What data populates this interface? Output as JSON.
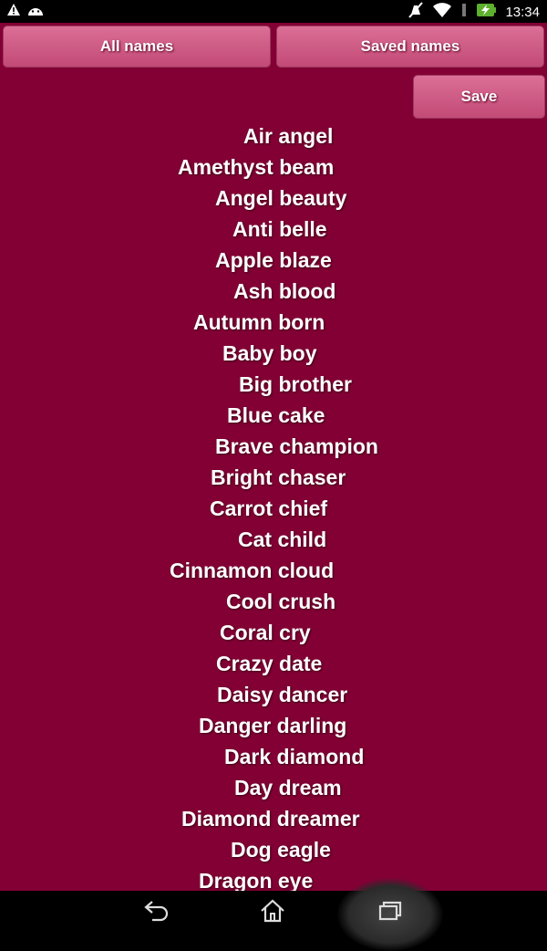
{
  "status_bar": {
    "time": "13:34",
    "icons": [
      "warning-icon",
      "android-icon",
      "mute-icon",
      "wifi-icon",
      "battery-charging-icon"
    ]
  },
  "buttons": {
    "all_names": "All names",
    "saved_names": "Saved names",
    "save": "Save"
  },
  "names": [
    "Air angel",
    "Amethyst beam",
    "Angel beauty",
    "Anti belle",
    "Apple blaze",
    "Ash blood",
    "Autumn born",
    "Baby boy",
    "Big brother",
    "Blue cake",
    "Brave champion",
    "Bright chaser",
    "Carrot chief",
    "Cat child",
    "Cinnamon cloud",
    "Cool crush",
    "Coral cry",
    "Crazy date",
    "Daisy dancer",
    "Danger darling",
    "Dark diamond",
    "Day dream",
    "Diamond dreamer",
    "Dog eagle",
    "Dragon eye"
  ],
  "nav_bar": {
    "icons": [
      "back-icon",
      "home-icon",
      "recent-apps-icon"
    ]
  },
  "colors": {
    "background": "#830035",
    "button": "#cf5c85"
  }
}
